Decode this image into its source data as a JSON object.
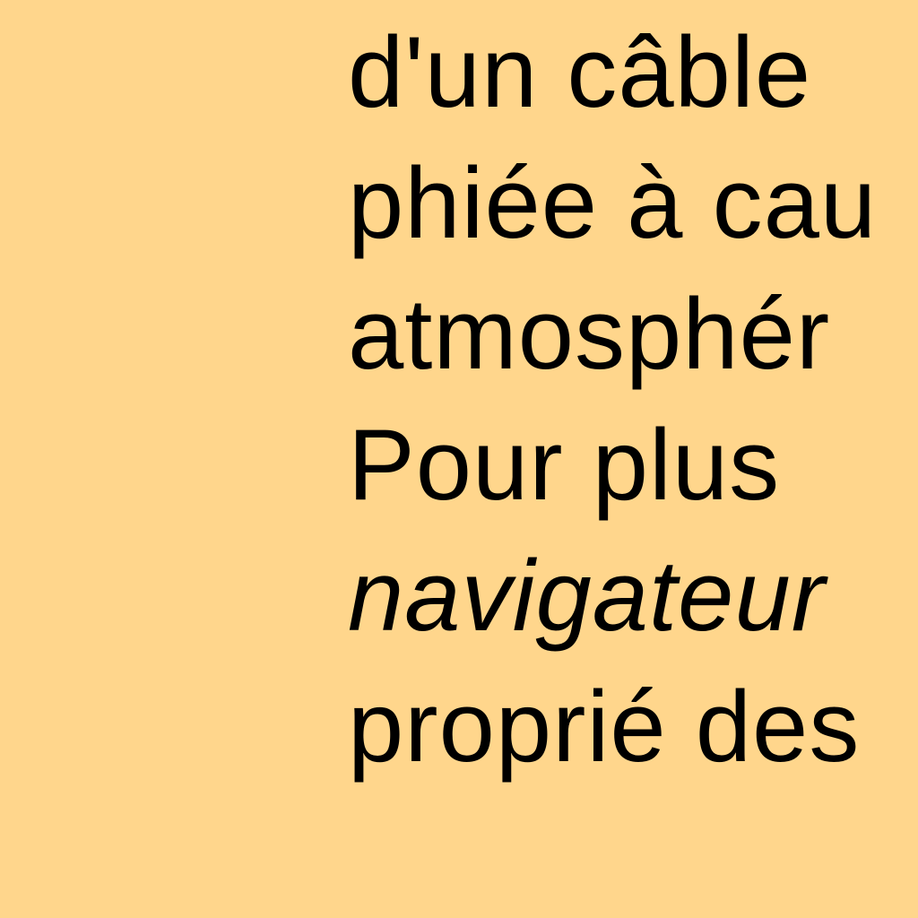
{
  "colors": {
    "background": "#ffd68c",
    "text": "#000000"
  },
  "text_block": {
    "lines": [
      {
        "text": "d'un câble",
        "italic": false
      },
      {
        "text": "phiée à cau",
        "italic": false
      },
      {
        "text": "atmosphér",
        "italic": false
      },
      {
        "text": "Pour plus",
        "italic": false
      },
      {
        "text": "navigateur",
        "italic": true
      },
      {
        "text": "proprié des",
        "italic": false
      }
    ]
  }
}
